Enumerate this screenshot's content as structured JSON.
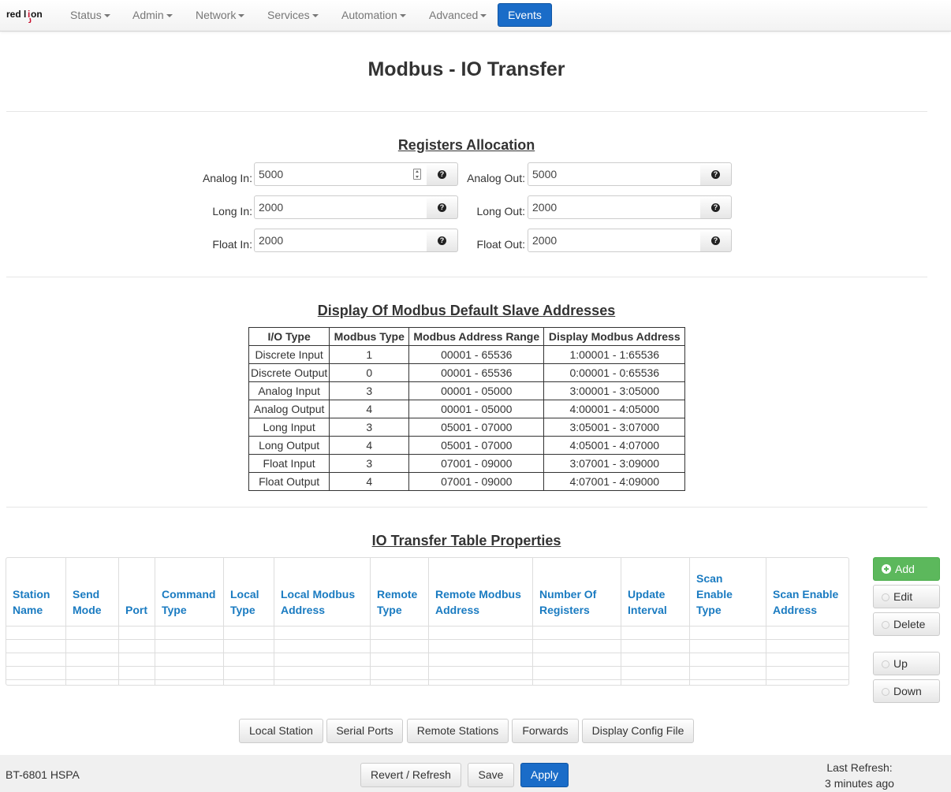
{
  "nav": {
    "items": [
      {
        "label": "Status"
      },
      {
        "label": "Admin"
      },
      {
        "label": "Network"
      },
      {
        "label": "Services"
      },
      {
        "label": "Automation"
      },
      {
        "label": "Advanced"
      }
    ],
    "events_label": "Events"
  },
  "page_title": "Modbus - IO Transfer",
  "registers": {
    "title": "Registers Allocation",
    "analog_in": {
      "label": "Analog In:",
      "value": "5000"
    },
    "analog_out": {
      "label": "Analog Out:",
      "value": "5000"
    },
    "long_in": {
      "label": "Long In:",
      "value": "2000"
    },
    "long_out": {
      "label": "Long Out:",
      "value": "2000"
    },
    "float_in": {
      "label": "Float In:",
      "value": "2000"
    },
    "float_out": {
      "label": "Float Out:",
      "value": "2000"
    }
  },
  "addresses": {
    "title": "Display Of Modbus Default Slave Addresses",
    "headers": [
      "I/O Type",
      "Modbus Type",
      "Modbus Address Range",
      "Display Modbus Address"
    ],
    "rows": [
      [
        "Discrete Input",
        "1",
        "00001 - 65536",
        "1:00001 - 1:65536"
      ],
      [
        "Discrete Output",
        "0",
        "00001 - 65536",
        "0:00001 - 0:65536"
      ],
      [
        "Analog Input",
        "3",
        "00001 - 05000",
        "3:00001 - 3:05000"
      ],
      [
        "Analog Output",
        "4",
        "00001 - 05000",
        "4:00001 - 4:05000"
      ],
      [
        "Long Input",
        "3",
        "05001 - 07000",
        "3:05001 - 3:07000"
      ],
      [
        "Long Output",
        "4",
        "05001 - 07000",
        "4:05001 - 4:07000"
      ],
      [
        "Float Input",
        "3",
        "07001 - 09000",
        "3:07001 - 3:09000"
      ],
      [
        "Float Output",
        "4",
        "07001 - 09000",
        "4:07001 - 4:09000"
      ]
    ]
  },
  "io_table": {
    "title": "IO Transfer Table Properties",
    "headers": [
      [
        "Station",
        "Name"
      ],
      [
        "Send",
        "Mode"
      ],
      [
        "Port"
      ],
      [
        "Command",
        "Type"
      ],
      [
        "Local",
        "Type"
      ],
      [
        "Local Modbus",
        "Address"
      ],
      [
        "Remote",
        "Type"
      ],
      [
        "Remote Modbus",
        "Address"
      ],
      [
        "Number Of",
        "Registers"
      ],
      [
        "Update",
        "Interval"
      ],
      [
        "Scan",
        "Enable",
        "Type"
      ],
      [
        "Scan Enable",
        "Address"
      ]
    ]
  },
  "side_buttons": {
    "add": "Add",
    "edit": "Edit",
    "delete": "Delete",
    "up": "Up",
    "down": "Down"
  },
  "bottom_nav": {
    "local_station": "Local Station",
    "serial_ports": "Serial Ports",
    "remote_stations": "Remote Stations",
    "forwards": "Forwards",
    "display_config": "Display Config File"
  },
  "footer": {
    "device": "BT-6801 HSPA",
    "revert": "Revert / Refresh",
    "save": "Save",
    "apply": "Apply",
    "last_refresh_label": "Last Refresh:",
    "last_refresh_value": "3 minutes ago"
  },
  "colors": {
    "primary": "#1a6cc8",
    "success": "#5cb85c",
    "header_link": "#1a7bc1"
  }
}
